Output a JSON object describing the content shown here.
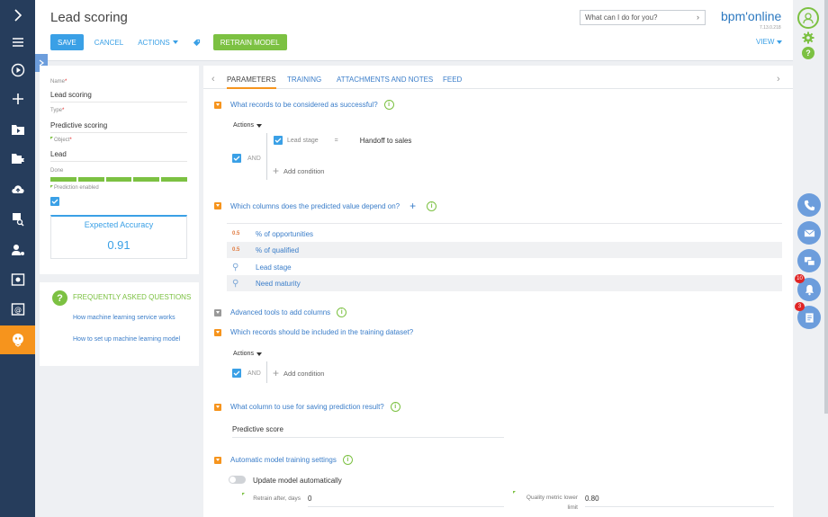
{
  "nav": {
    "items": [
      {
        "name": "expand-icon",
        "active": false
      },
      {
        "name": "menu-icon",
        "active": false
      },
      {
        "name": "play-icon",
        "active": false
      },
      {
        "name": "plus-icon",
        "active": false
      },
      {
        "name": "folder-play-icon",
        "active": false
      },
      {
        "name": "folder-flag-icon",
        "active": false
      },
      {
        "name": "cloud-upload-icon",
        "active": false
      },
      {
        "name": "report-search-icon",
        "active": false
      },
      {
        "name": "user-settings-icon",
        "active": false
      },
      {
        "name": "target-icon",
        "active": false
      },
      {
        "name": "email-icon",
        "active": false
      },
      {
        "name": "ml-bot-icon",
        "active": true
      }
    ]
  },
  "header": {
    "title": "Lead scoring",
    "search_placeholder": "What can I do for you?",
    "logo": "bpm'online",
    "version": "7.13.0.218",
    "view_label": "VIEW"
  },
  "toolbar": {
    "save": "SAVE",
    "cancel": "CANCEL",
    "actions": "ACTIONS",
    "retrain": "RETRAIN MODEL"
  },
  "record": {
    "name_label": "Name",
    "name_value": "Lead scoring",
    "type_label": "Type",
    "type_value": "Predictive scoring",
    "object_label": "Object",
    "object_value": "Lead",
    "status_label": "Done",
    "progress_steps": 5,
    "prediction_label": "Prediction enabled",
    "prediction_enabled": true,
    "accuracy_title": "Expected Accuracy",
    "accuracy_value": "0.91"
  },
  "faq": {
    "title": "FREQUENTLY ASKED QUESTIONS",
    "links": [
      "How machine learning service works",
      "How to set up machine learning model"
    ]
  },
  "tabs": [
    "PARAMETERS",
    "TRAINING",
    "ATTACHMENTS AND NOTES",
    "FEED"
  ],
  "sections": {
    "success": {
      "title": "What records to be considered as successful?",
      "actions": "Actions",
      "and": "AND",
      "condition_field": "Lead stage",
      "condition_op": "=",
      "condition_value": "Handoff to sales",
      "add_condition": "Add condition"
    },
    "columns": {
      "title": "Which columns does the predicted value depend on?",
      "rows": [
        {
          "icon": "0.5",
          "label": "% of opportunities"
        },
        {
          "icon": "0.5",
          "label": "% of qualified"
        },
        {
          "icon": "search",
          "label": "Lead stage"
        },
        {
          "icon": "search",
          "label": "Need maturity"
        }
      ]
    },
    "advanced": {
      "title": "Advanced tools to add columns"
    },
    "training": {
      "title": "Which records should be included in the training dataset?",
      "actions": "Actions",
      "and": "AND",
      "add_condition": "Add condition"
    },
    "save_result": {
      "title": "What column to use for saving prediction result?",
      "value": "Predictive score"
    },
    "auto": {
      "title": "Automatic model training settings",
      "toggle_label": "Update model automatically",
      "retrain_label": "Retrain after, days",
      "retrain_value": "0",
      "quality_label": "Quality metric lower limit",
      "quality_value": "0.80"
    }
  },
  "right_panel": {
    "notifications_count": "10",
    "tasks_count": "3"
  },
  "colors": {
    "nav_bg": "#263d5c",
    "accent_orange": "#f6941d",
    "accent_blue": "#3aa0e6",
    "accent_green": "#7cc142"
  }
}
